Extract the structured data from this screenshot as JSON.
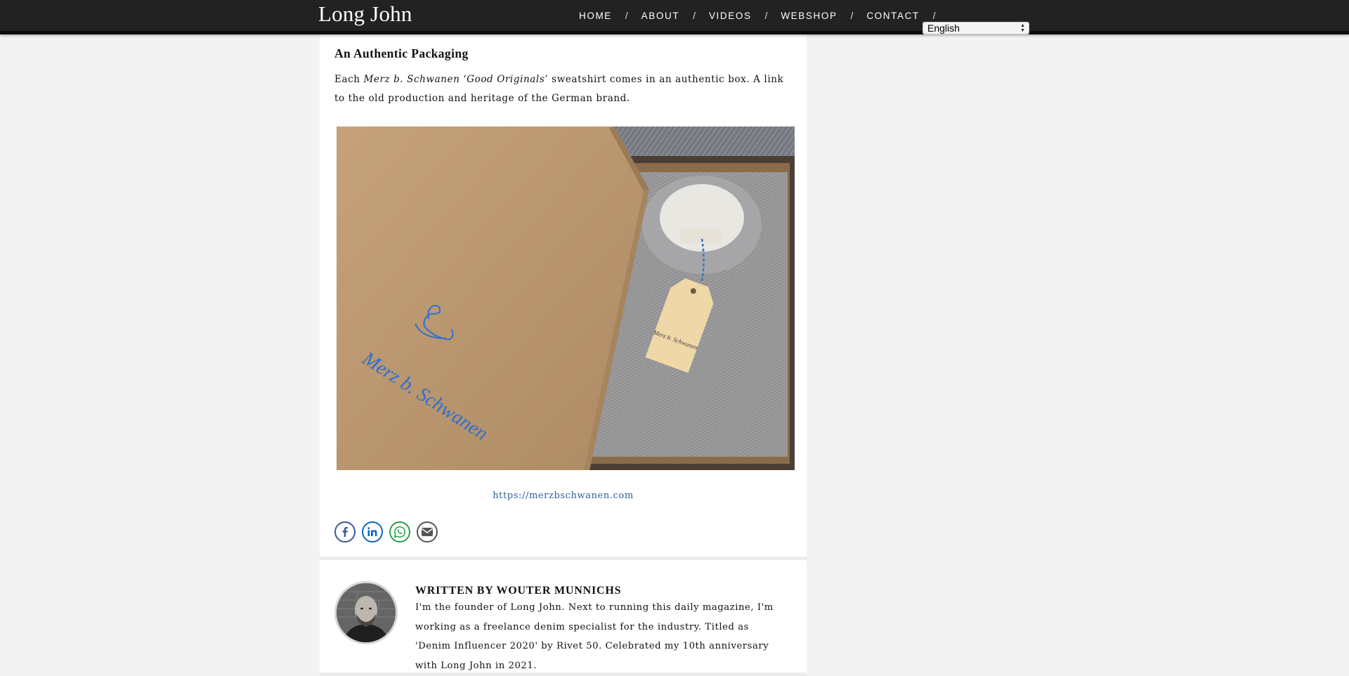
{
  "site": {
    "logo": "Long John"
  },
  "nav": {
    "items": [
      {
        "label": "HOME"
      },
      {
        "label": "ABOUT"
      },
      {
        "label": "VIDEOS"
      },
      {
        "label": "WEBSHOP"
      },
      {
        "label": "CONTACT"
      }
    ],
    "separator": "/"
  },
  "language_select": {
    "value": "English"
  },
  "article": {
    "heading": "An Authentic Packaging",
    "paragraph": {
      "before": "Each ",
      "emphasis": "Merz b. Schwanen ‘Good Originals’",
      "after": " sweatshirt comes in an authentic box. A link to the old production and heritage of the German brand."
    },
    "image": {
      "box_brand": "Merz b. Schwanen",
      "tag_brand": "Merz b. Schwanen"
    },
    "link": "https://merzbschwanen.com"
  },
  "share": [
    {
      "network": "facebook",
      "icon": "facebook-icon",
      "color": "#3b5998"
    },
    {
      "network": "linkedin",
      "icon": "linkedin-icon",
      "color": "#0a66c2"
    },
    {
      "network": "whatsapp",
      "icon": "whatsapp-icon",
      "color": "#25a244"
    },
    {
      "network": "email",
      "icon": "email-icon",
      "color": "#555555"
    }
  ],
  "author": {
    "title": "WRITTEN BY WOUTER MUNNICHS",
    "bio": "I'm the founder of Long John. Next to running this daily magazine, I'm working as a freelance denim specialist for the industry. Titled as 'Denim Influencer 2020' by Rivet 50. Celebrated my 10th anniversary with Long John in 2021."
  },
  "colors": {
    "topbar": "#222222",
    "page_background": "#f3f3f3",
    "link": "#2f5f9a"
  }
}
